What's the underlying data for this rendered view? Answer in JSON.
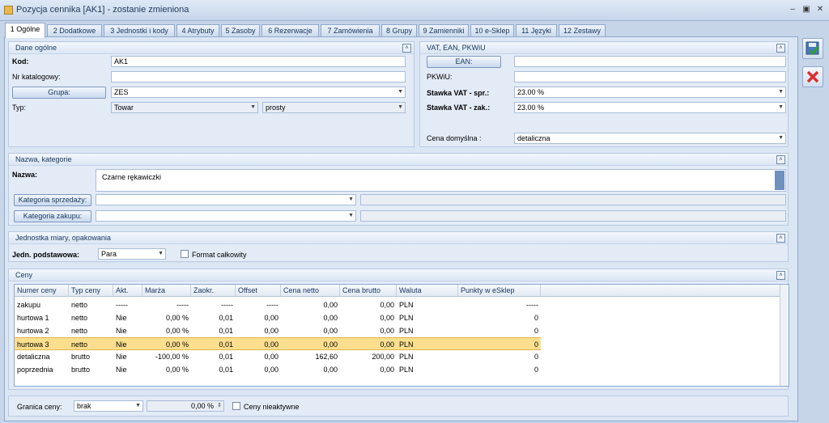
{
  "window": {
    "title": "Pozycja cennika [AK1] - zostanie zmieniona"
  },
  "tabs": [
    "1 Ogólne",
    "2 Dodatkowe",
    "3 Jednostki i kody",
    "4 Atrybuty",
    "5 Zasoby",
    "6 Rezerwacje",
    "7 Zamówienia",
    "8 Grupy",
    "9 Zamienniki",
    "10 e-Sklep",
    "11 Języki",
    "12 Zestawy"
  ],
  "general": {
    "header": "Dane ogólne",
    "kod_label": "Kod:",
    "kod_value": "AK1",
    "nr_kat_label": "Nr katalogowy:",
    "nr_kat_value": "",
    "grupa_button": "Grupa:",
    "grupa_value": "ZES",
    "typ_label": "Typ:",
    "typ_value": "Towar",
    "typ_sub_value": "prosty"
  },
  "vat": {
    "header": "VAT, EAN, PKWiU",
    "ean_button": "EAN:",
    "ean_value": "",
    "pkwiu_label": "PKWiU:",
    "pkwiu_value": "",
    "stawka_spr_label": "Stawka VAT - spr.:",
    "stawka_spr_value": "23.00 %",
    "stawka_zak_label": "Stawka VAT - zak.:",
    "stawka_zak_value": "23.00 %",
    "cena_label": "Cena domyślna :",
    "cena_value": "detaliczna"
  },
  "name": {
    "header": "Nazwa, kategorie",
    "nazwa_label": "Nazwa:",
    "nazwa_value": "Czarne rękawiczki",
    "kat_sprzedazy_button": "Kategoria sprzedaży:",
    "kat_zakupu_button": "Kategoria zakupu:"
  },
  "unit": {
    "header": "Jednostka miary, opakowania",
    "jedn_label": "Jedn. podstawowa:",
    "jedn_value": "Para",
    "format_label": "Format całkowity"
  },
  "prices": {
    "header": "Ceny",
    "columns": [
      "Numer ceny",
      "Typ ceny",
      "Akt.",
      "Marża",
      "Zaokr.",
      "Offset",
      "Cena netto",
      "Cena brutto",
      "Waluta",
      "Punkty w eSklep"
    ],
    "rows": [
      [
        "zakupu",
        "netto",
        "-----",
        "-----",
        "-----",
        "-----",
        "0,00",
        "0,00",
        "PLN",
        "-----"
      ],
      [
        "hurtowa 1",
        "netto",
        "Nie",
        "0,00 %",
        "0,01",
        "0,00",
        "0,00",
        "0,00",
        "PLN",
        "0"
      ],
      [
        "hurtowa 2",
        "netto",
        "Nie",
        "0,00 %",
        "0,01",
        "0,00",
        "0,00",
        "0,00",
        "PLN",
        "0"
      ],
      [
        "hurtowa 3",
        "netto",
        "Nie",
        "0,00 %",
        "0,01",
        "0,00",
        "0,00",
        "0,00",
        "PLN",
        "0"
      ],
      [
        "detaliczna",
        "brutto",
        "Nie",
        "-100,00 %",
        "0,01",
        "0,00",
        "162,60",
        "200,00",
        "PLN",
        "0"
      ],
      [
        "poprzednia",
        "brutto",
        "Nie",
        "0,00 %",
        "0,01",
        "0,00",
        "0,00",
        "0,00",
        "PLN",
        "0"
      ]
    ],
    "selected_row_index": 3
  },
  "footer": {
    "granica_label": "Granica ceny:",
    "granica_value": "brak",
    "percent_value": "0,00 %",
    "nieaktywne_label": "Ceny nieaktywne"
  },
  "colors": {
    "accent": "#15355e",
    "selected_row": "#fbdf8e",
    "cancel": "#d93030",
    "save": "#2e7d32"
  }
}
